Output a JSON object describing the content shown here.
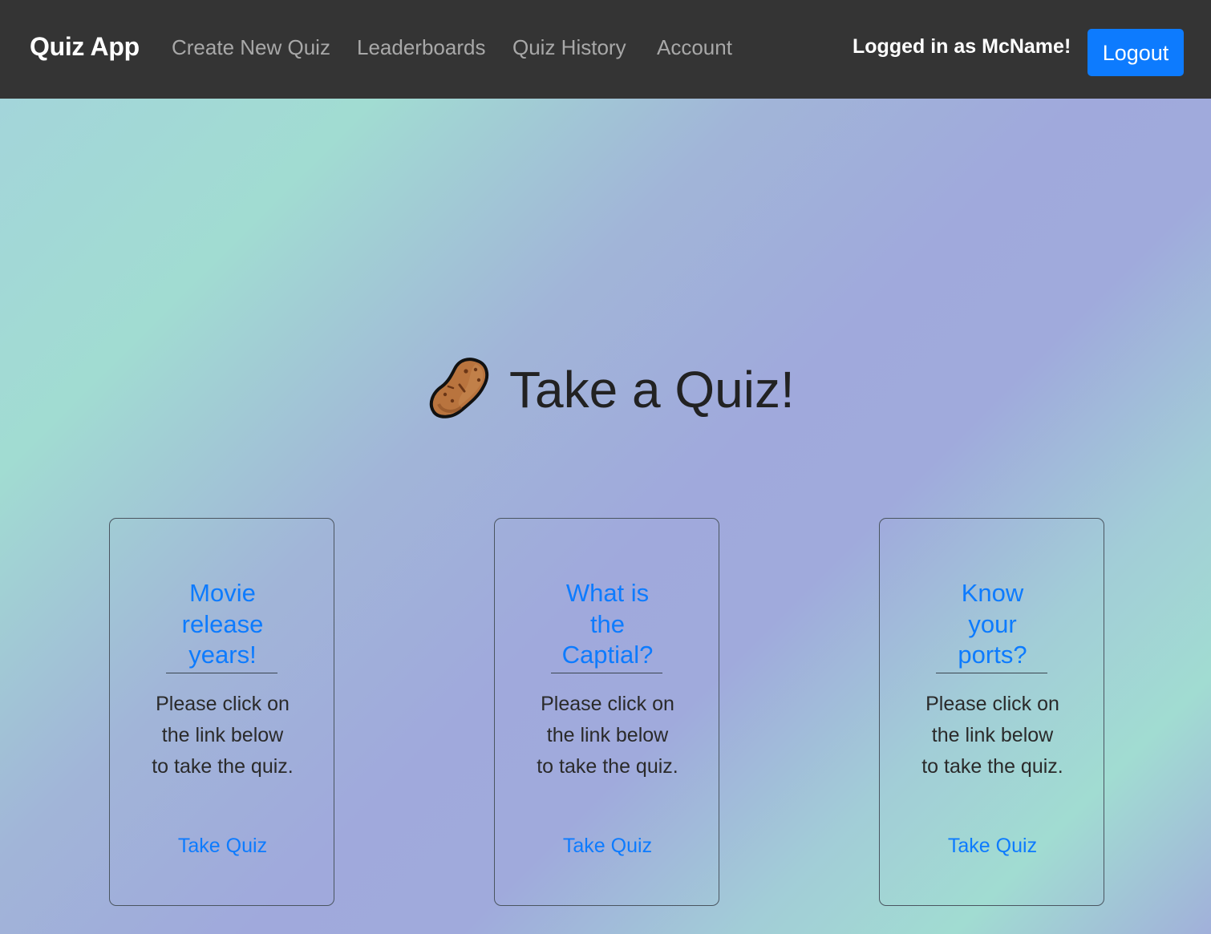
{
  "navbar": {
    "brand": "Quiz App",
    "links": [
      {
        "label": "Create New Quiz"
      },
      {
        "label": "Leaderboards"
      },
      {
        "label": "Quiz History"
      },
      {
        "label": "Account"
      }
    ],
    "logged_in_text": "Logged in as McName!",
    "logout_label": "Logout",
    "background": "#343434",
    "accent": "#0d7bfe"
  },
  "hero": {
    "icon": "potato-icon",
    "title": "Take a Quiz!"
  },
  "cards": [
    {
      "title": "Movie release years!",
      "text": "Please click on the link below to take the quiz.",
      "link_label": "Take Quiz"
    },
    {
      "title": "What is the Captial?",
      "text": "Please click on the link below to take the quiz.",
      "link_label": "Take Quiz"
    },
    {
      "title": "Know your ports?",
      "text": "Please click on the link below to take the quiz.",
      "link_label": "Take Quiz"
    }
  ]
}
